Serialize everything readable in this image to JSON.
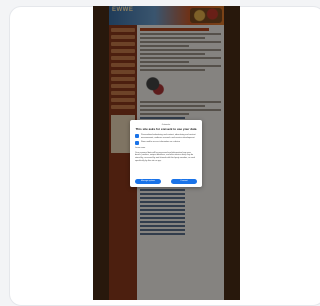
{
  "site": {
    "logo_text": "EWWE"
  },
  "consent_dialog": {
    "brand": "Gutensite",
    "title": "This site asks for consent to use your data",
    "options": [
      "Personalised advertising and content, advertising and content measurement, audience research and services development",
      "Store and/or access information on a device"
    ],
    "learn_more": "Learn more",
    "notice": "Your personal data will be processed and information from your device (cookies, unique identifiers, and other device data) may be stored by, accessed by and shared with third party vendors, or used specifically by this site or app.",
    "buttons": {
      "manage": "Manage options",
      "consent": "Consent"
    }
  },
  "colors": {
    "accent": "#1a73e8",
    "site_brown": "#4a2c16",
    "nav_red": "#8a3a1d"
  }
}
